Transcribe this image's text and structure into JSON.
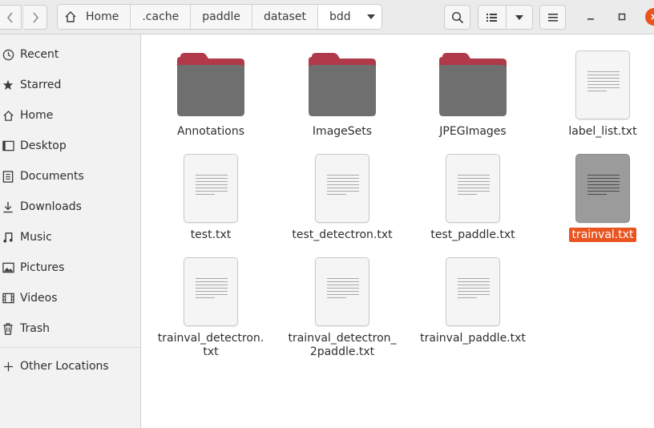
{
  "toolbar": {
    "back_icon": "chevron-left-icon",
    "forward_icon": "chevron-right-icon",
    "breadcrumbs": [
      {
        "label": "Home",
        "icon": "home-icon"
      },
      {
        "label": ".cache"
      },
      {
        "label": "paddle"
      },
      {
        "label": "dataset"
      },
      {
        "label": "bdd",
        "current": true
      }
    ],
    "search_icon": "search-icon",
    "view_icon": "list-view-icon",
    "view_menu_icon": "chevron-down-icon",
    "menu_icon": "hamburger-menu-icon"
  },
  "window_controls": {
    "close_color": "#e95420"
  },
  "sidebar": {
    "items": [
      {
        "label": "Recent",
        "icon": "clock-icon"
      },
      {
        "label": "Starred",
        "icon": "star-icon"
      },
      {
        "label": "Home",
        "icon": "home-icon"
      },
      {
        "label": "Desktop",
        "icon": "desktop-icon"
      },
      {
        "label": "Documents",
        "icon": "document-icon"
      },
      {
        "label": "Downloads",
        "icon": "download-icon"
      },
      {
        "label": "Music",
        "icon": "music-icon"
      },
      {
        "label": "Pictures",
        "icon": "picture-icon"
      },
      {
        "label": "Videos",
        "icon": "video-icon"
      },
      {
        "label": "Trash",
        "icon": "trash-icon"
      }
    ],
    "other_locations": {
      "label": "Other Locations",
      "icon": "plus-icon"
    }
  },
  "files": [
    {
      "name": "Annotations",
      "type": "folder"
    },
    {
      "name": "ImageSets",
      "type": "folder"
    },
    {
      "name": "JPEGImages",
      "type": "folder"
    },
    {
      "name": "label_list.txt",
      "type": "text"
    },
    {
      "name": "test.txt",
      "type": "text"
    },
    {
      "name": "test_detectron.txt",
      "type": "text"
    },
    {
      "name": "test_paddle.txt",
      "type": "text"
    },
    {
      "name": "trainval.txt",
      "type": "text",
      "selected": true
    },
    {
      "name_line1": "trainval_detectron.",
      "name_line2": "txt",
      "name": "trainval_detectron.txt",
      "type": "text"
    },
    {
      "name_line1": "trainval_detectron_",
      "name_line2": "2paddle.txt",
      "name": "trainval_detectron_2paddle.txt",
      "type": "text"
    },
    {
      "name": "trainval_paddle.txt",
      "type": "text"
    }
  ],
  "colors": {
    "accent": "#e95420",
    "folder_tab": "#b03a4a",
    "folder_body": "#6f6f6f"
  }
}
